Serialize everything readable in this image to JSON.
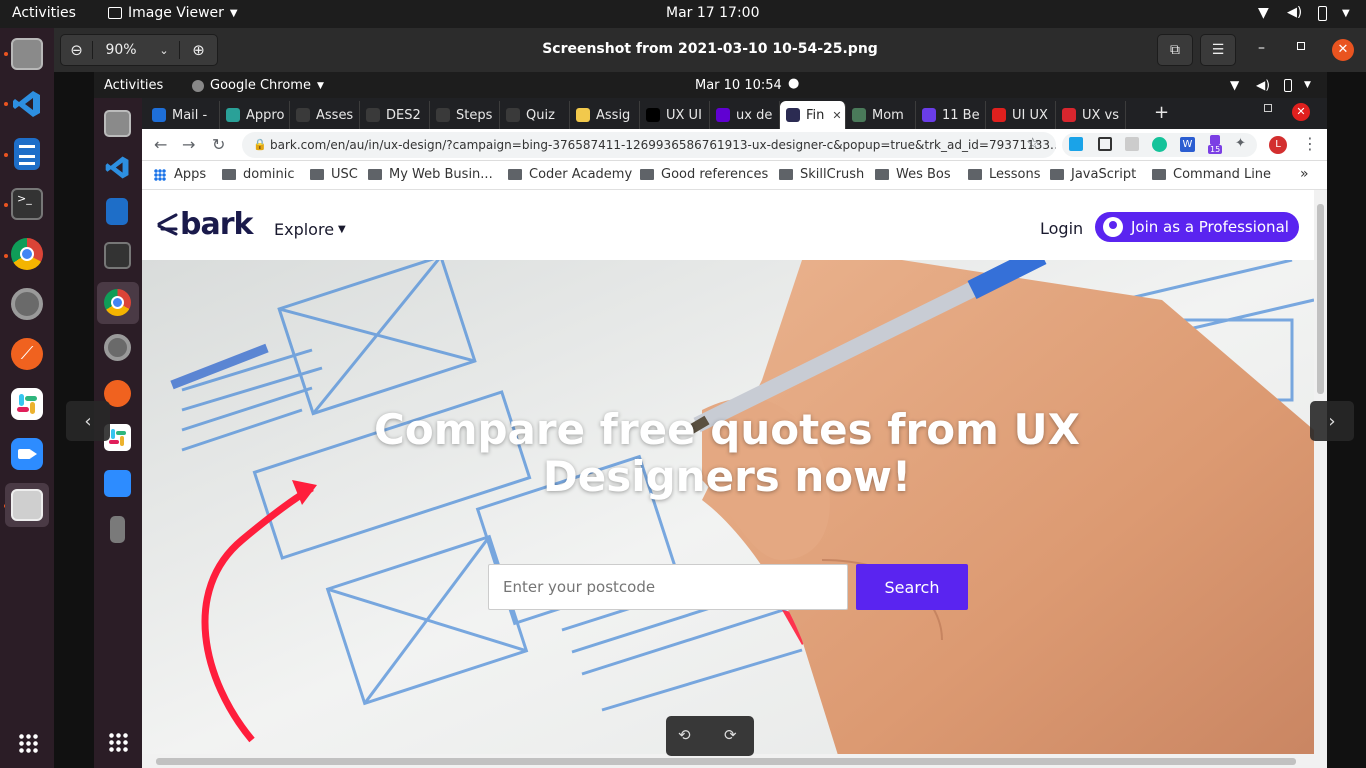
{
  "desktop": {
    "activities": "Activities",
    "app_menu": "Image Viewer",
    "clock": "Mar 17  17:00"
  },
  "viewer": {
    "zoom": "90%",
    "title": "Screenshot from 2021-03-10 10-54-25.png"
  },
  "inner_desktop": {
    "activities": "Activities",
    "app_menu": "Google Chrome",
    "clock": "Mar 10  10:54"
  },
  "tabs": [
    {
      "label": "Mail -",
      "icon": "mail-icon",
      "color": "#1e6fd9"
    },
    {
      "label": "Appro",
      "icon": "app-icon",
      "color": "#2aa198"
    },
    {
      "label": "Asses",
      "icon": "bb-icon",
      "color": "#3a3a3a"
    },
    {
      "label": "DES2",
      "icon": "bb-icon",
      "color": "#3a3a3a"
    },
    {
      "label": "Steps",
      "icon": "bb-icon",
      "color": "#3a3a3a"
    },
    {
      "label": "Quiz",
      "icon": "bb-icon",
      "color": "#3a3a3a"
    },
    {
      "label": "Assig",
      "icon": "figma-icon",
      "color": "#f2c94c"
    },
    {
      "label": "UX UI",
      "icon": "page-icon",
      "color": "#000000"
    },
    {
      "label": "ux de",
      "icon": "yahoo-icon",
      "color": "#6001d2"
    },
    {
      "label": "Fin",
      "icon": "bark-icon",
      "color": "#2b2b52"
    },
    {
      "label": "Mom",
      "icon": "globe-icon",
      "color": "#4a7a5a"
    },
    {
      "label": "11 Be",
      "icon": "page-icon",
      "color": "#6a3de8"
    },
    {
      "label": "UI UX",
      "icon": "opera-icon",
      "color": "#e0201e"
    },
    {
      "label": "UX vs",
      "icon": "ux-icon",
      "color": "#d8262e"
    }
  ],
  "address": {
    "url": "bark.com/en/au/in/ux-design/?campaign=bing-376587411-1269936586761913-ux-designer-c&popup=true&trk_ad_id=79371133..."
  },
  "bookmarks": {
    "apps": "Apps",
    "items": [
      "dominic",
      "USC",
      "My Web Busin...",
      "Coder Academy",
      "Good references",
      "SkillCrush",
      "Wes Bos",
      "Lessons",
      "JavaScript",
      "Command Line"
    ],
    "more": "»"
  },
  "extensions": {
    "badge": "15",
    "profile": "L"
  },
  "site": {
    "logo": "bark",
    "explore": "Explore",
    "login": "Login",
    "join": "Join as a Professional",
    "headline": "Compare free quotes from UX Designers now!",
    "postcode_placeholder": "Enter your postcode",
    "search": "Search"
  },
  "colors": {
    "accent": "#e95420",
    "bark_purple": "#5a24f0",
    "bark_navy": "#1a1a4b"
  }
}
